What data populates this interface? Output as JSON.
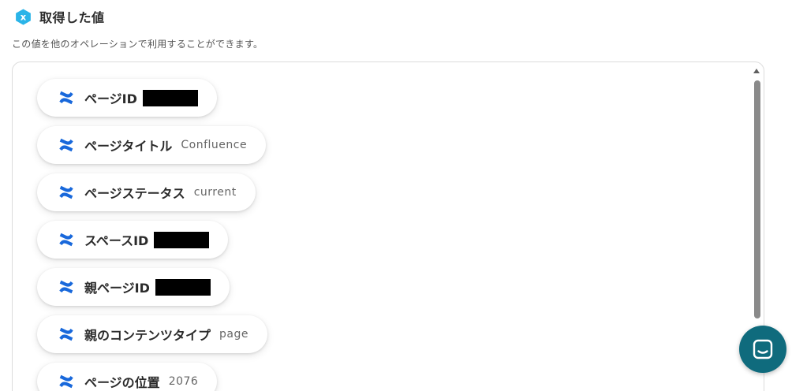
{
  "header": {
    "title": "取得した値",
    "icon": "variable-x-icon",
    "icon_color": "#2ab4e8"
  },
  "subtitle": "この値を他のオペレーションで利用することができます。",
  "fields": [
    {
      "label": "ページID",
      "value": "",
      "redacted": true
    },
    {
      "label": "ページタイトル",
      "value": "Confluence",
      "redacted": false
    },
    {
      "label": "ページステータス",
      "value": "current",
      "redacted": false
    },
    {
      "label": "スペースID",
      "value": "",
      "redacted": true
    },
    {
      "label": "親ページID",
      "value": "",
      "redacted": true
    },
    {
      "label": "親のコンテンツタイプ",
      "value": "page",
      "redacted": false
    },
    {
      "label": "ページの位置",
      "value": "2076",
      "redacted": false
    }
  ],
  "field_icon": "confluence-icon",
  "colors": {
    "confluence_blue": "#1868db",
    "chat_button": "#0f6b7d"
  },
  "chat": {
    "icon": "chat-bubble-icon"
  }
}
